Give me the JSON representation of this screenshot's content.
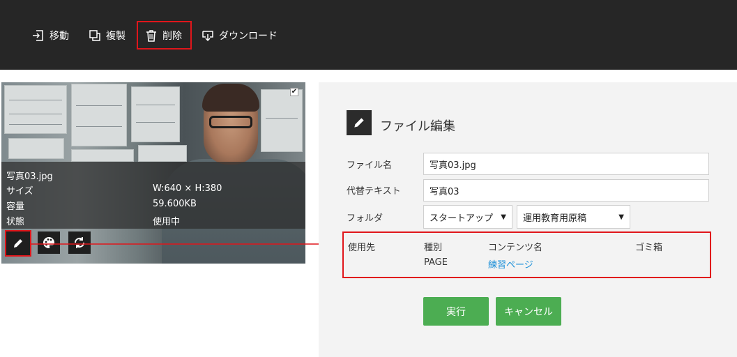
{
  "toolbar": {
    "move_label": "移動",
    "copy_label": "複製",
    "delete_label": "削除",
    "download_label": "ダウンロード"
  },
  "image_card": {
    "filename": "写真03.jpg",
    "size_label": "サイズ",
    "size_value": "W:640 × H:380",
    "capacity_label": "容量",
    "capacity_value": "59.600KB",
    "status_label": "状態",
    "status_value": "使用中",
    "selected": true,
    "actions": [
      "pencil-icon",
      "palette-icon",
      "rotate-icon"
    ]
  },
  "edit_panel": {
    "title": "ファイル編集",
    "filename_label": "ファイル名",
    "filename_value": "写真03.jpg",
    "alt_label": "代替テキスト",
    "alt_value": "写真03",
    "folder_label": "フォルダ",
    "folder_parent": "スタートアップ",
    "folder_child": "運用教育用原稿",
    "usage": {
      "label": "使用先",
      "headers": {
        "type": "種別",
        "content": "コンテンツ名",
        "trash": "ゴミ箱"
      },
      "rows": [
        {
          "type": "PAGE",
          "content": "練習ページ",
          "trash": ""
        }
      ]
    },
    "run_label": "実行",
    "cancel_label": "キャンセル"
  },
  "colors": {
    "toolbar_bg": "#262626",
    "highlight": "#e0161b",
    "button_green": "#4cad52",
    "link": "#1a8fd8",
    "panel_bg": "#f3f3f3"
  }
}
